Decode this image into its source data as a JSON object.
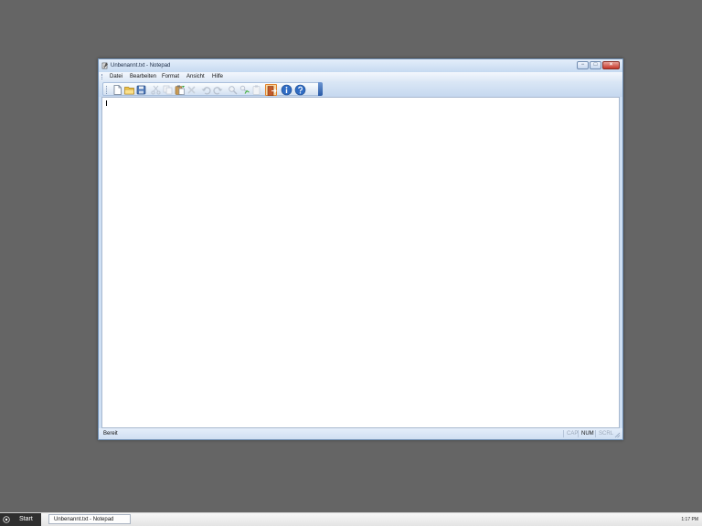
{
  "window": {
    "title": "Unbenannt.txt - Notepad",
    "controls": {
      "minimize": "−",
      "maximize": "□",
      "close": "×"
    }
  },
  "menu": {
    "items": [
      {
        "label": "Datei"
      },
      {
        "label": "Bearbeiten"
      },
      {
        "label": "Format"
      },
      {
        "label": "Ansicht"
      },
      {
        "label": "Hilfe"
      }
    ]
  },
  "toolbar": {
    "buttons": [
      {
        "icon": "new-document-icon",
        "enabled": true
      },
      {
        "icon": "open-folder-icon",
        "enabled": true
      },
      {
        "icon": "save-icon",
        "enabled": true
      },
      {
        "icon": "cut-icon",
        "enabled": false
      },
      {
        "icon": "copy-icon",
        "enabled": false
      },
      {
        "icon": "paste-icon",
        "enabled": true
      },
      {
        "icon": "delete-icon",
        "enabled": false
      },
      {
        "icon": "undo-icon",
        "enabled": false
      },
      {
        "icon": "redo-icon",
        "enabled": false
      },
      {
        "icon": "find-icon",
        "enabled": false
      },
      {
        "icon": "replace-icon",
        "enabled": false
      },
      {
        "icon": "clipboard-icon",
        "enabled": false
      },
      {
        "icon": "exit-icon",
        "enabled": true,
        "active": true
      },
      {
        "icon": "info-icon",
        "enabled": true
      },
      {
        "icon": "help-icon",
        "enabled": true
      }
    ]
  },
  "editor": {
    "content": ""
  },
  "status": {
    "text": "Bereit",
    "indicators": [
      {
        "label": "CAP",
        "on": false
      },
      {
        "label": "NUM",
        "on": true
      },
      {
        "label": "SCRL",
        "on": false
      }
    ]
  },
  "taskbar": {
    "start_label": "Start",
    "items": [
      {
        "label": "Unbenannt.txt - Notepad"
      }
    ],
    "clock": "1:17 PM"
  },
  "colors": {
    "desktop": "#656565",
    "window_frame": "#cfe0f4",
    "close_button": "#c5362a",
    "active_tool": "#fbd9a3",
    "toolbar_accent": "#2a5aa6"
  }
}
